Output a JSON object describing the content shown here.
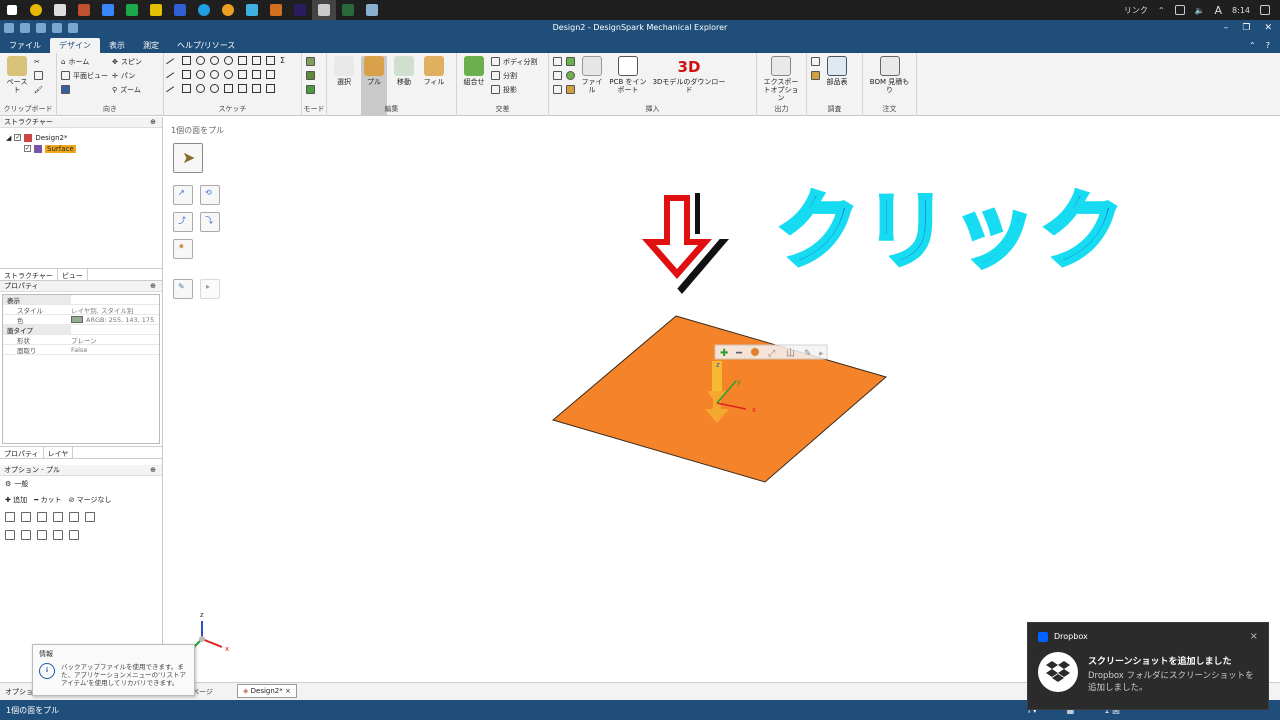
{
  "window": {
    "title": "Design2 - DesignSpark Mechanical Explorer"
  },
  "taskbar": {
    "tray_link": "リンク",
    "ime": "A",
    "clock": "8:14"
  },
  "menu": {
    "tabs": [
      "ファイル",
      "デザイン",
      "表示",
      "測定",
      "ヘルプ/リソース"
    ],
    "active": "デザイン"
  },
  "ribbon": {
    "clipboard": {
      "paste": "ペースト",
      "label": "クリップボード"
    },
    "orient": {
      "home": "ホーム",
      "spin": "スピン",
      "plan": "平面ビュー",
      "pan": "パン",
      "zoom": "ズーム",
      "label": "向き"
    },
    "sketch": {
      "label": "スケッチ"
    },
    "mode": {
      "label": "モード"
    },
    "edit": {
      "select": "選択",
      "pull": "プル",
      "move": "移動",
      "fill": "フィル",
      "label": "編集"
    },
    "intersect": {
      "combine": "組合せ",
      "split_body": "ボディ分割",
      "split": "分割",
      "project": "投影",
      "label": "交差"
    },
    "insert": {
      "file": "ファイル",
      "pcb": "PCB をインポート",
      "dl3d_badge": "3D",
      "dl3d": "3Dモデルのダウンロード",
      "label": "挿入"
    },
    "output": {
      "export": "エクスポートオプション",
      "label": "出力"
    },
    "investigate": {
      "parts": "部品表",
      "label": "調査"
    },
    "order": {
      "bom": "BOM 見積もり",
      "label": "注文"
    }
  },
  "structure": {
    "title": "ストラクチャー",
    "pin": "⊕",
    "root": "Design2*",
    "child": "Surface",
    "tabs": [
      "ストラクチャー",
      "ビュー"
    ]
  },
  "properties": {
    "title": "プロパティ",
    "pin": "⊕",
    "sections": [
      {
        "name": "表示",
        "rows": [
          {
            "k": "スタイル",
            "v": "レイヤ別, スタイル別"
          },
          {
            "k": "色",
            "v": "ARGB: 255, 143, 175"
          }
        ]
      },
      {
        "name": "面タイプ",
        "rows": [
          {
            "k": "形状",
            "v": "プレーン"
          },
          {
            "k": "面取り",
            "v": "False"
          }
        ]
      }
    ],
    "tabs": [
      "プロパティ",
      "レイヤ"
    ]
  },
  "options": {
    "title": "オプション - プル",
    "pin": "⊕",
    "general": "一般",
    "add": "追加",
    "cut": "カット",
    "nomerge": "マージなし"
  },
  "canvas": {
    "hint": "1個の面をプル",
    "callout": "クリック",
    "axis": {
      "x": "x",
      "y": "y",
      "z": "z"
    }
  },
  "bottom_tabs": {
    "options": "オプショ",
    "start": "トページ",
    "doc": "Design2*"
  },
  "info": {
    "title": "情報",
    "icon": "i",
    "text": "バックアップファイルを使用できます。また、アプリケーションメニューの'リストアアイテム'を使用してリカバリできます。"
  },
  "status": {
    "left": "1個の面をプル",
    "info": "i",
    "right_label": "1 面"
  },
  "toast": {
    "app": "Dropbox",
    "close": "×",
    "title": "スクリーンショットを追加しました",
    "text": "Dropbox フォルダにスクリーンショットを追加しました。"
  },
  "colors": {
    "accent": "#1f4e7a",
    "face": "#f5832a",
    "callout_fill": "#1670e0",
    "callout_stroke": "#17dbf0",
    "arrow": "#e01010"
  }
}
